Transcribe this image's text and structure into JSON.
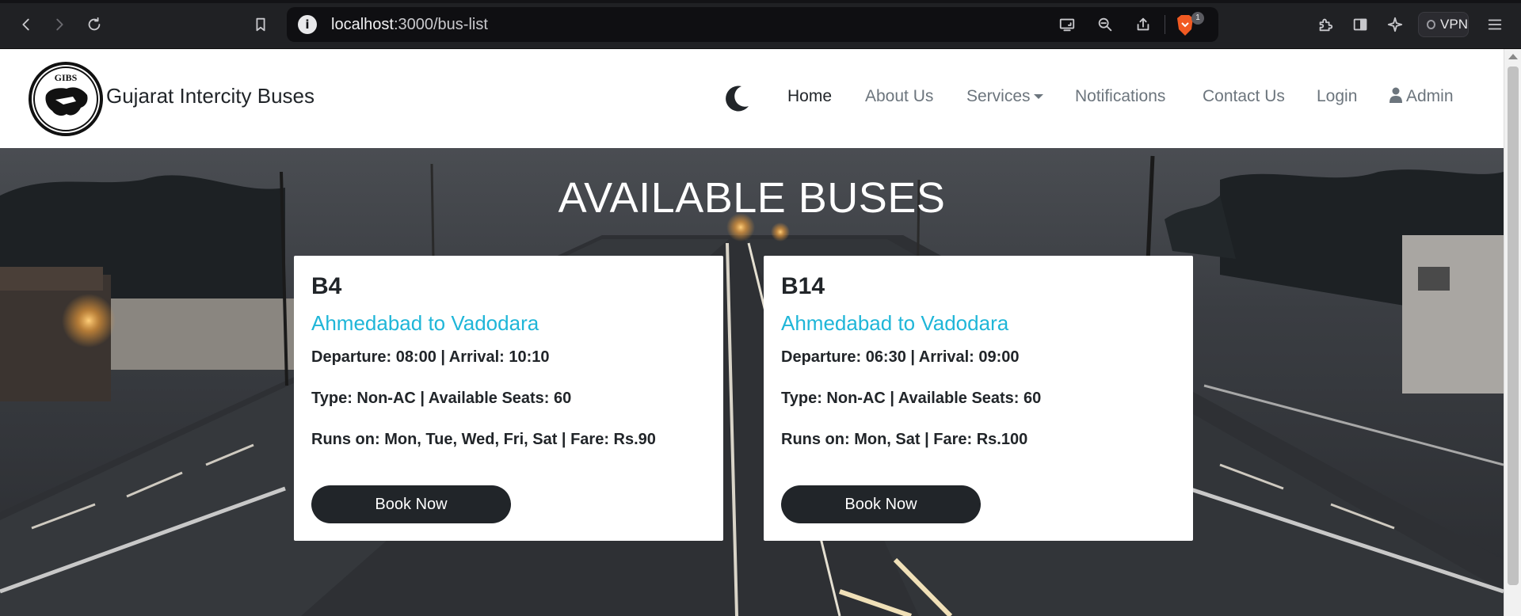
{
  "browser": {
    "url_host": "localhost",
    "url_path": ":3000/bus-list",
    "vpn_label": "VPN",
    "shield_badge": "1",
    "info_icon": "i",
    "icons": [
      "back-icon",
      "forward-icon",
      "reload-icon",
      "bookmark-icon",
      "cast-icon",
      "zoom-out-icon",
      "share-icon",
      "brave-shield-icon",
      "extensions-icon",
      "sidebar-icon",
      "leo-ai-icon",
      "menu-icon"
    ]
  },
  "navbar": {
    "logo_text": "GIBS",
    "brand": "Gujarat Intercity Buses",
    "theme_icon": "moon-icon",
    "links": {
      "home": "Home",
      "about": "About Us",
      "services": "Services",
      "notifications": "Notifications",
      "contact": "Contact Us",
      "login": "Login",
      "admin": "Admin"
    }
  },
  "page": {
    "title": "AVAILABLE BUSES"
  },
  "buses": [
    {
      "code": "B4",
      "route": "Ahmedabad to Vadodara",
      "timing": "Departure: 08:00 | Arrival: 10:10",
      "type_seats": "Type: Non-AC | Available Seats: 60",
      "runs_fare": "Runs on: Mon, Tue, Wed, Fri, Sat | Fare: Rs.90",
      "book_label": "Book Now"
    },
    {
      "code": "B14",
      "route": "Ahmedabad to Vadodara",
      "timing": "Departure: 06:30 | Arrival: 09:00",
      "type_seats": "Type: Non-AC | Available Seats: 60",
      "runs_fare": "Runs on: Mon, Sat | Fare: Rs.100",
      "book_label": "Book Now"
    }
  ],
  "colors": {
    "route_accent": "#1fb6d8",
    "button_dark": "#212529",
    "navbar_bg": "#ffffff"
  }
}
